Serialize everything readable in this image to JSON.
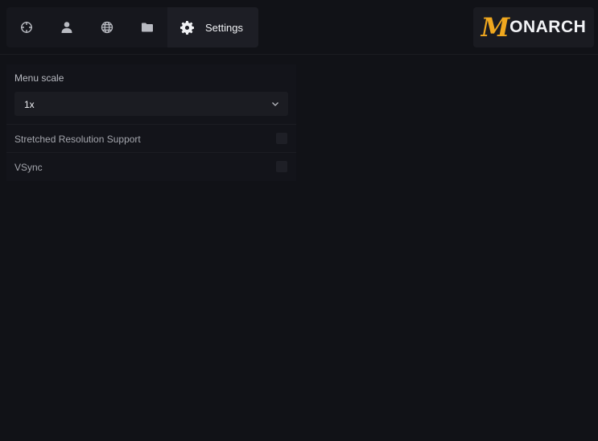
{
  "tabs": [
    {
      "icon": "crosshair-icon",
      "label": ""
    },
    {
      "icon": "user-icon",
      "label": ""
    },
    {
      "icon": "globe-icon",
      "label": ""
    },
    {
      "icon": "folder-icon",
      "label": ""
    },
    {
      "icon": "gear-icon",
      "label": "Settings",
      "active": true
    }
  ],
  "logo": {
    "initial": "M",
    "text": "ONARCH",
    "accent_color": "#f0a81f"
  },
  "settings": {
    "menu_scale": {
      "label": "Menu scale",
      "value": "1x"
    },
    "stretched_resolution": {
      "label": "Stretched Resolution Support",
      "checked": false
    },
    "vsync": {
      "label": "VSync",
      "checked": false
    }
  },
  "colors": {
    "background": "#111217",
    "panel": "#13141a",
    "accent": "#f0a81f"
  }
}
